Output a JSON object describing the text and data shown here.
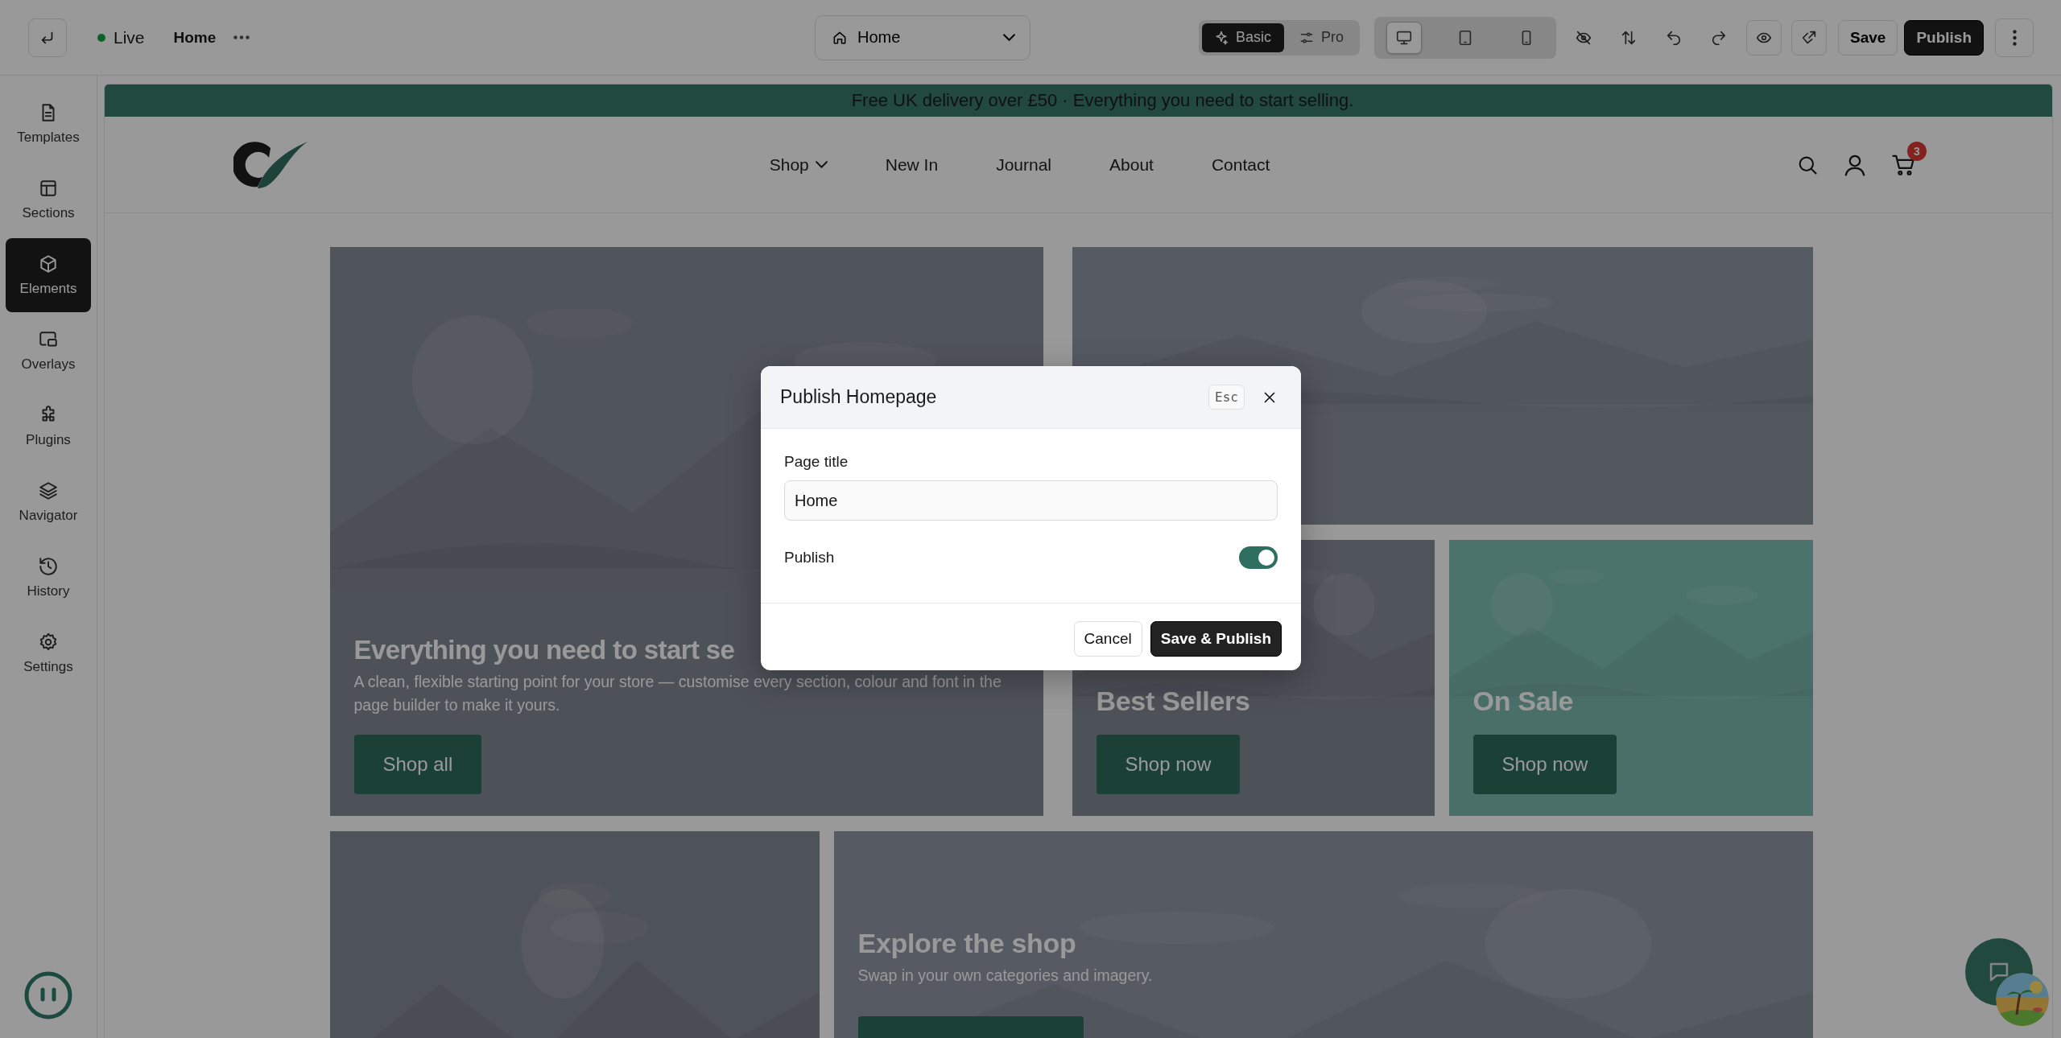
{
  "toolbar": {
    "status": "Live",
    "page": "Home",
    "page_selector": "Home",
    "modes": [
      {
        "label": "Basic",
        "selected": true
      },
      {
        "label": "Pro",
        "selected": false
      }
    ],
    "devices": [
      {
        "kind": "desktop",
        "selected": true
      },
      {
        "kind": "tablet",
        "selected": false
      },
      {
        "kind": "mobile",
        "selected": false
      }
    ],
    "save": "Save",
    "publish": "Publish"
  },
  "sidebar": {
    "items": [
      {
        "label": "Templates",
        "selected": false
      },
      {
        "label": "Sections",
        "selected": false
      },
      {
        "label": "Elements",
        "selected": true
      },
      {
        "label": "Overlays",
        "selected": false
      },
      {
        "label": "Plugins",
        "selected": false
      },
      {
        "label": "Navigator",
        "selected": false
      },
      {
        "label": "History",
        "selected": false
      },
      {
        "label": "Settings",
        "selected": false
      }
    ]
  },
  "store": {
    "announcement": "Free UK delivery over £50 · Everything you need to start selling.",
    "nav": [
      {
        "label": "Shop",
        "dropdown": true
      },
      {
        "label": "New In",
        "dropdown": false
      },
      {
        "label": "Journal",
        "dropdown": false
      },
      {
        "label": "About",
        "dropdown": false
      },
      {
        "label": "Contact",
        "dropdown": false
      }
    ],
    "cart_count": "3",
    "tiles": [
      {
        "kind": "banner",
        "title": "Everything you need to start se",
        "text": "A clean, flexible starting point for your store — customise every section, colour and font in the page builder to make it yours.",
        "button": "Shop all"
      },
      {
        "kind": "picture"
      },
      {
        "kind": "banner",
        "title": "Best Sellers",
        "button": "Shop now"
      },
      {
        "kind": "banner",
        "title": "On Sale",
        "button": "Shop now"
      },
      {
        "kind": "picture"
      },
      {
        "kind": "banner",
        "title": "Explore the shop",
        "text": "Swap in your own categories and imagery.",
        "button_cut": true
      }
    ]
  },
  "modal": {
    "title": "Publish Homepage",
    "shortcut": "Esc",
    "field": {
      "label": "Page title",
      "value": "Home"
    },
    "toggle": {
      "label": "Publish",
      "on": true
    },
    "buttons": [
      {
        "label": "Cancel",
        "kind": "secondary"
      },
      {
        "label": "Save & Publish",
        "kind": "primary"
      }
    ]
  }
}
